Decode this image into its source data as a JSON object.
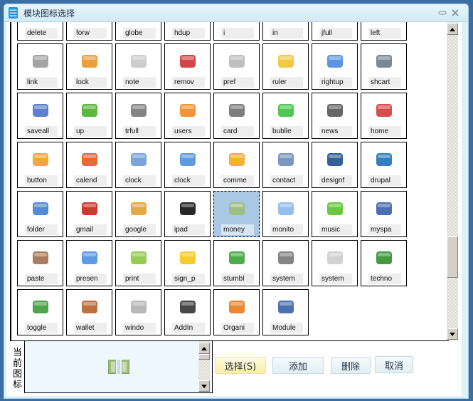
{
  "window": {
    "title": "模块图标选择",
    "minimize_glyph": "▭",
    "close_glyph": "✕"
  },
  "icons": [
    {
      "label": "delete",
      "icon": "delete-icon",
      "color": "#d93a3a"
    },
    {
      "label": "forw",
      "icon": "forward-icon",
      "color": "#4c7fd6"
    },
    {
      "label": "globe",
      "icon": "globe-icon",
      "color": "#3b83d4"
    },
    {
      "label": "hdup",
      "icon": "hdup-icon",
      "color": "#9a9a9a"
    },
    {
      "label": "i",
      "icon": "info-icon",
      "color": "#8ab4e8"
    },
    {
      "label": "in",
      "icon": "magnifier-icon",
      "color": "#555555"
    },
    {
      "label": "jfull",
      "icon": "jfull-icon",
      "color": "#6d84d8"
    },
    {
      "label": "left",
      "icon": "left-arrow-icon",
      "color": "#8cc63f"
    },
    {
      "label": "link",
      "icon": "link-icon",
      "color": "#9a9a9a"
    },
    {
      "label": "lock",
      "icon": "lock-icon",
      "color": "#e8952b"
    },
    {
      "label": "note",
      "icon": "note-icon",
      "color": "#c8c8c8"
    },
    {
      "label": "remov",
      "icon": "remove-icon",
      "color": "#cc3333"
    },
    {
      "label": "pref",
      "icon": "preferences-icon",
      "color": "#b8b8b8"
    },
    {
      "label": "ruler",
      "icon": "ruler-icon",
      "color": "#f2c230"
    },
    {
      "label": "rightup",
      "icon": "rightup-arrow-icon",
      "color": "#4a8be0"
    },
    {
      "label": "shcart",
      "icon": "shopping-cart-icon",
      "color": "#6b7a8a"
    },
    {
      "label": "saveall",
      "icon": "save-all-icon",
      "color": "#4a74c9"
    },
    {
      "label": "up",
      "icon": "up-arrow-icon",
      "color": "#4caf2a"
    },
    {
      "label": "trfull",
      "icon": "trash-full-icon",
      "color": "#777777"
    },
    {
      "label": "users",
      "icon": "users-icon",
      "color": "#f08a24"
    },
    {
      "label": "card",
      "icon": "card-icon",
      "color": "#707070"
    },
    {
      "label": "bublle",
      "icon": "speech-bubble-icon",
      "color": "#3cc23c"
    },
    {
      "label": "news",
      "icon": "news-icon",
      "color": "#555555"
    },
    {
      "label": "home",
      "icon": "home-icon",
      "color": "#d43a3a"
    },
    {
      "label": "button",
      "icon": "rss-button-icon",
      "color": "#f0a020"
    },
    {
      "label": "calend",
      "icon": "calendar-icon",
      "color": "#e05a2a"
    },
    {
      "label": "clock",
      "icon": "clock-icon",
      "color": "#6a9bd8"
    },
    {
      "label": "clock",
      "icon": "alarm-clock-icon",
      "color": "#4a90d9"
    },
    {
      "label": "comme",
      "icon": "comments-icon",
      "color": "#f5a623"
    },
    {
      "label": "contact",
      "icon": "contact-icon",
      "color": "#6a8bb8"
    },
    {
      "label": "designf",
      "icon": "designfloat-icon",
      "color": "#1e4f8f"
    },
    {
      "label": "drupal",
      "icon": "drupal-icon",
      "color": "#1d70b7"
    },
    {
      "label": "folder",
      "icon": "folder-icon",
      "color": "#3f7fcf"
    },
    {
      "label": "gmail",
      "icon": "gmail-icon",
      "color": "#c8231b"
    },
    {
      "label": "google",
      "icon": "google-icon",
      "color": "#e0a030"
    },
    {
      "label": "ipad",
      "icon": "ipad-icon",
      "color": "#111111"
    },
    {
      "label": "money",
      "icon": "money-icon",
      "color": "#9bbd7a",
      "selected": true
    },
    {
      "label": "monito",
      "icon": "monitor-icon",
      "color": "#8ab8e8"
    },
    {
      "label": "music",
      "icon": "music-icon",
      "color": "#5cc12a"
    },
    {
      "label": "myspa",
      "icon": "myspace-icon",
      "color": "#3a5fa8"
    },
    {
      "label": "paste",
      "icon": "paste-icon",
      "color": "#a0704a"
    },
    {
      "label": "presen",
      "icon": "present-icon",
      "color": "#4a8fe0"
    },
    {
      "label": "print",
      "icon": "print-icon",
      "color": "#8cc63f"
    },
    {
      "label": "sign_p",
      "icon": "pedestrian-sign-icon",
      "color": "#f5c518"
    },
    {
      "label": "stumbl",
      "icon": "stumbleupon-icon",
      "color": "#3aa33a"
    },
    {
      "label": "system",
      "icon": "system-equalizer-icon",
      "color": "#777777"
    },
    {
      "label": "system",
      "icon": "system-switch-icon",
      "color": "#cccccc"
    },
    {
      "label": "techno",
      "icon": "technorati-icon",
      "color": "#2f8f2f"
    },
    {
      "label": "toggle",
      "icon": "toggle-icon",
      "color": "#3a9a3a"
    },
    {
      "label": "wallet",
      "icon": "wallet-icon",
      "color": "#b8602a"
    },
    {
      "label": "windo",
      "icon": "window-icon",
      "color": "#b0b0b0"
    },
    {
      "label": "AddIn",
      "icon": "addin-piano-icon",
      "color": "#333333"
    },
    {
      "label": "Organi",
      "icon": "organization-icon",
      "color": "#e87a1a"
    },
    {
      "label": "Module",
      "icon": "module-store-icon",
      "color": "#3a5fa8"
    }
  ],
  "scroll": {
    "position_fraction": 0.8
  },
  "current": {
    "label": "当前图标",
    "icon": "money-icon"
  },
  "buttons": {
    "select": "选择(S)",
    "add": "添加",
    "delete": "删除",
    "cancel": "取消"
  }
}
